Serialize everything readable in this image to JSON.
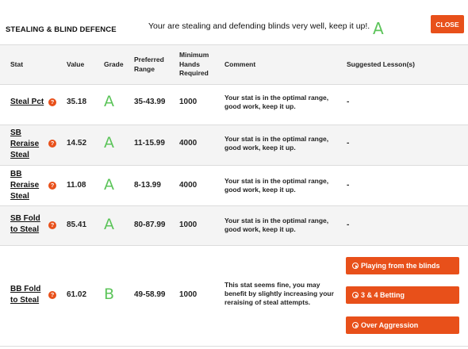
{
  "header": {
    "section_title": "STEALING & BLIND DEFENCE",
    "summary_message": "Your are stealing and defending blinds very well, keep it up!.",
    "summary_grade": "A",
    "close_label": "CLOSE"
  },
  "table": {
    "columns": {
      "stat": "Stat",
      "value": "Value",
      "grade": "Grade",
      "preferred_range_1": "Preferred",
      "preferred_range_2": "Range",
      "min_hands_1": "Minimum",
      "min_hands_2": "Hands",
      "min_hands_3": "Required",
      "comment": "Comment",
      "lessons": "Suggested Lesson(s)"
    },
    "rows": [
      {
        "stat_lines": [
          "Steal Pct"
        ],
        "value": "35.18",
        "grade": "A",
        "range": "35-43.99",
        "min_hands": "1000",
        "comment_lines": [
          "Your stat is in the optimal range,",
          "good work, keep it up."
        ],
        "lesson": "-"
      },
      {
        "stat_lines": [
          "SB",
          "Reraise",
          "Steal"
        ],
        "value": "14.52",
        "grade": "A",
        "range": "11-15.99",
        "min_hands": "4000",
        "comment_lines": [
          "Your stat is in the optimal range,",
          "good work, keep it up."
        ],
        "lesson": "-"
      },
      {
        "stat_lines": [
          "BB",
          "Reraise",
          "Steal"
        ],
        "value": "11.08",
        "grade": "A",
        "range": "8-13.99",
        "min_hands": "4000",
        "comment_lines": [
          "Your stat is in the optimal range,",
          "good work, keep it up."
        ],
        "lesson": "-"
      },
      {
        "stat_lines": [
          "SB Fold",
          "to Steal"
        ],
        "value": "85.41",
        "grade": "A",
        "range": "80-87.99",
        "min_hands": "1000",
        "comment_lines": [
          "Your stat is in the optimal range,",
          "good work, keep it up."
        ],
        "lesson": "-"
      },
      {
        "stat_lines": [
          "BB Fold",
          "to Steal"
        ],
        "value": "61.02",
        "grade": "B",
        "range": "49-58.99",
        "min_hands": "1000",
        "comment_lines": [
          "This stat seems fine, you may",
          "benefit by slightly increasing your",
          "reraising of steal attempts."
        ],
        "lesson_buttons": [
          "Playing from the blinds",
          "3 & 4 Betting",
          "Over Aggression"
        ]
      }
    ]
  },
  "colors": {
    "accent": "#e8501a",
    "grade_green": "#5cc45a",
    "row_alt": "#f4f4f4"
  },
  "icons": {
    "help": "question-circle-icon",
    "play": "play-circle-icon"
  }
}
